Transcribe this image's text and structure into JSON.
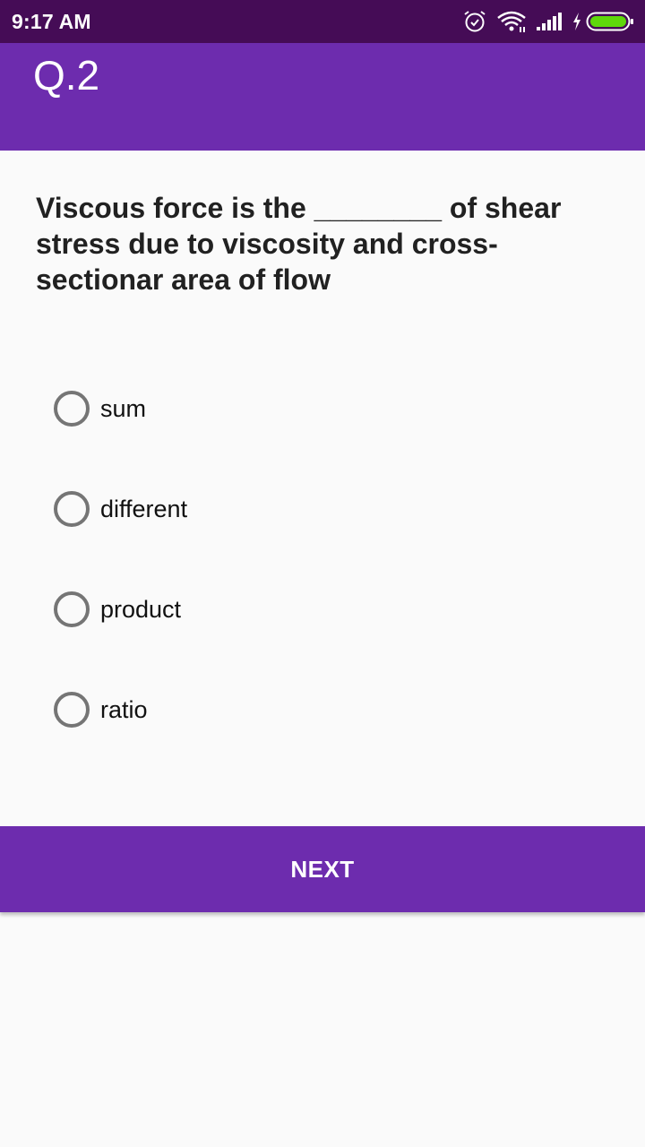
{
  "status_bar": {
    "time": "9:17 AM",
    "icons": [
      "alarm-icon",
      "wifi-icon",
      "signal-icon",
      "charging-icon",
      "battery-icon"
    ],
    "battery_color": "#5fd80b"
  },
  "app_bar": {
    "title": "Q.2",
    "color": "#6d2cae"
  },
  "question": {
    "text": "Viscous force is the ________ of shear stress due to viscosity and cross-sectionar area of flow"
  },
  "options": [
    {
      "label": "sum",
      "selected": false
    },
    {
      "label": "different",
      "selected": false
    },
    {
      "label": "product",
      "selected": false
    },
    {
      "label": "ratio",
      "selected": false
    }
  ],
  "next_button": {
    "label": "NEXT"
  }
}
